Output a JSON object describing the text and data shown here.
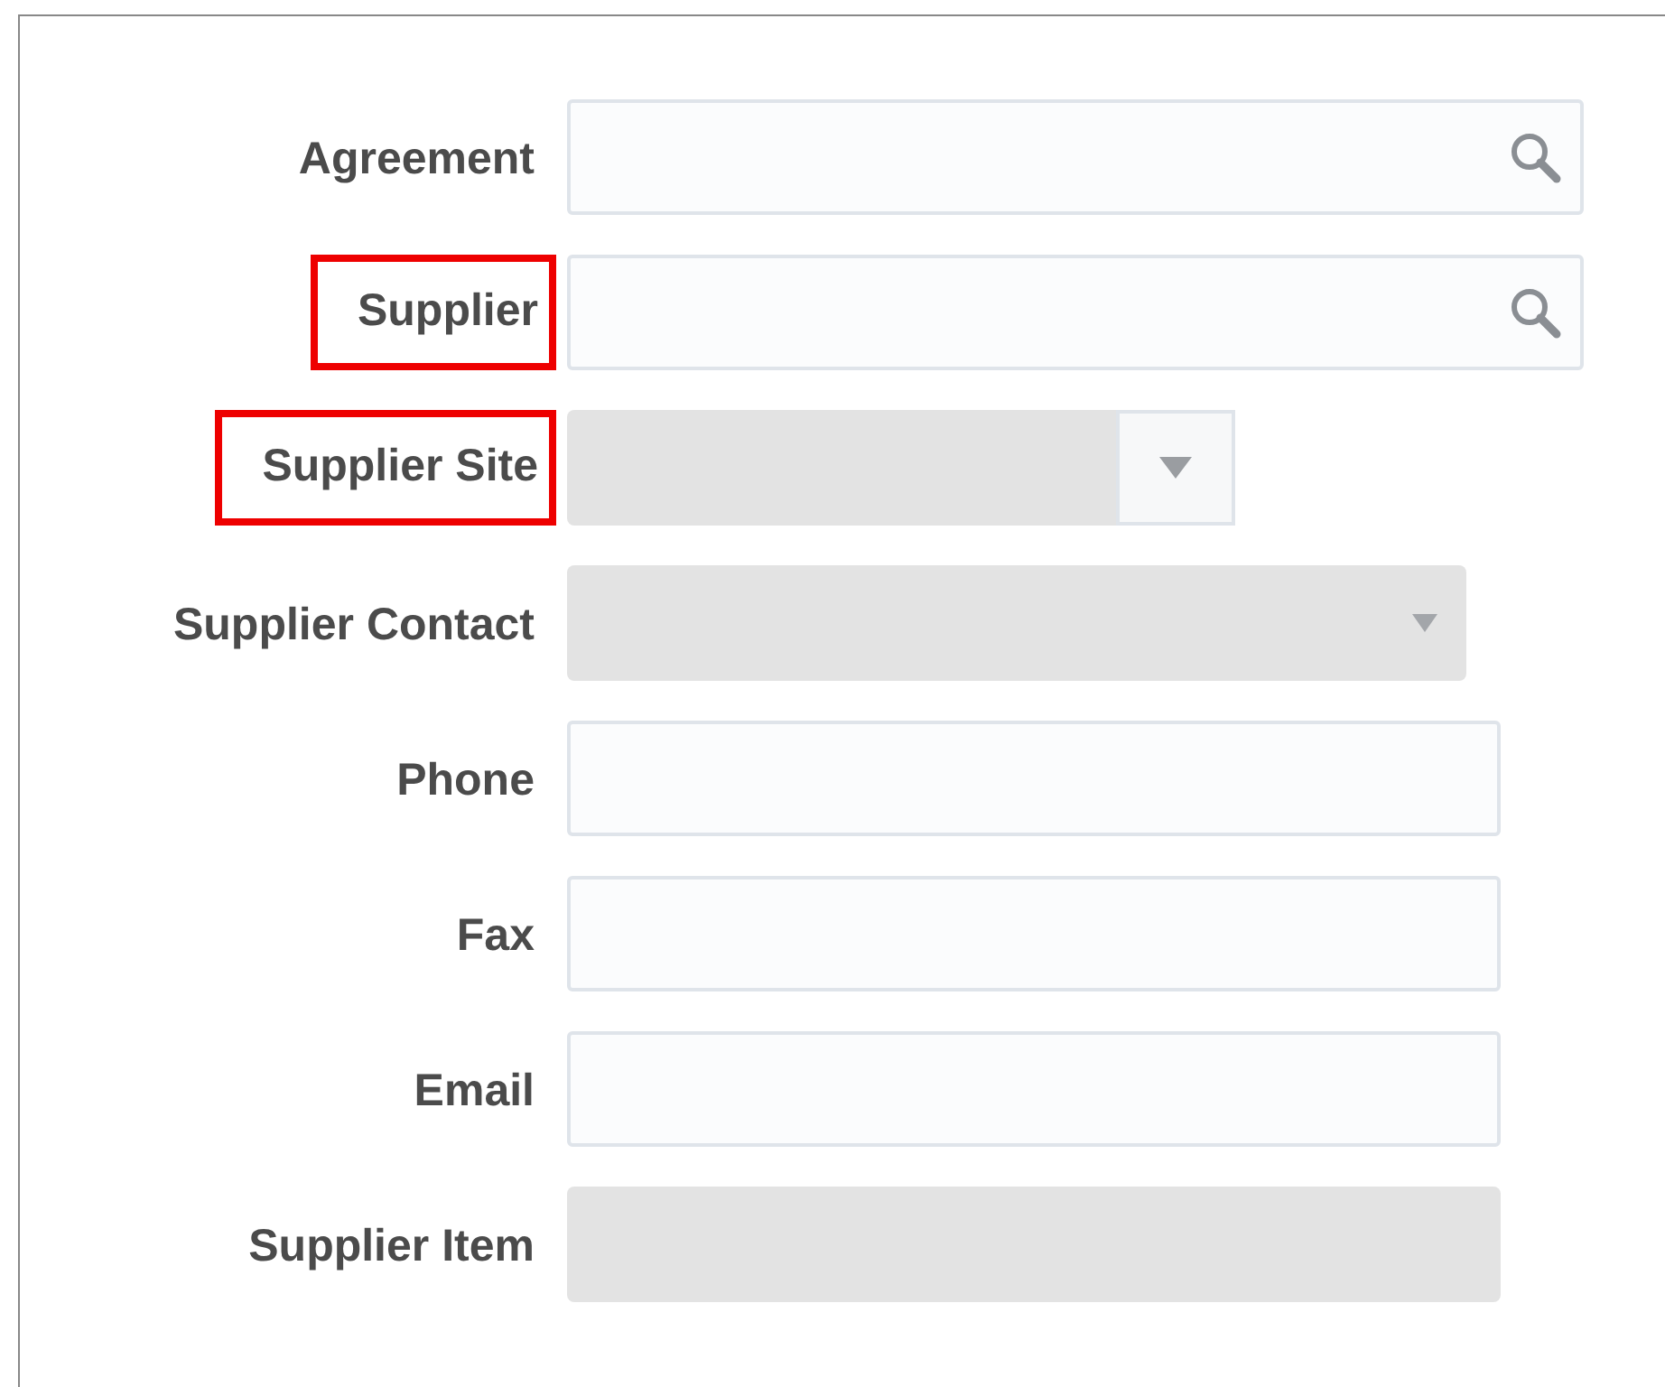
{
  "fields": [
    {
      "label": "Agreement",
      "kind": "lookup",
      "disabled": false,
      "highlighted": false
    },
    {
      "label": "Supplier",
      "kind": "lookup",
      "disabled": false,
      "highlighted": true
    },
    {
      "label": "Supplier Site",
      "kind": "choice_button",
      "disabled": true,
      "highlighted": true
    },
    {
      "label": "Supplier Contact",
      "kind": "choice",
      "disabled": true,
      "highlighted": false
    },
    {
      "label": "Phone",
      "kind": "text",
      "disabled": false,
      "highlighted": false
    },
    {
      "label": "Fax",
      "kind": "text",
      "disabled": false,
      "highlighted": false
    },
    {
      "label": "Email",
      "kind": "text",
      "disabled": false,
      "highlighted": false
    },
    {
      "label": "Supplier Item",
      "kind": "text",
      "disabled": true,
      "highlighted": false
    }
  ]
}
